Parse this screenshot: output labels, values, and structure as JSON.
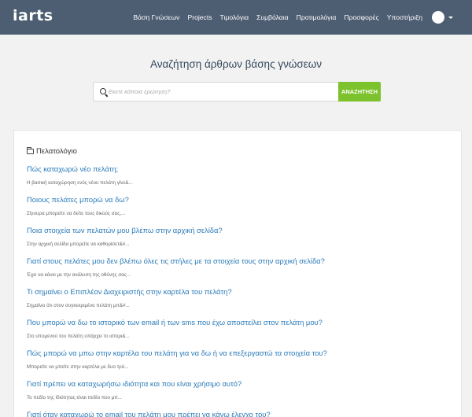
{
  "header": {
    "logo": "iarts",
    "nav": [
      "Βάση Γνώσεων",
      "Projects",
      "Τιμολόγια",
      "Συμβόλαια",
      "Προτιμολόγια",
      "Προσφορές",
      "Υποστήριξη"
    ],
    "avatar_icon": "user-avatar",
    "dropdown_icon": "caret-down-icon"
  },
  "hero": {
    "title": "Αναζήτηση άρθρων βάσης γνώσεων",
    "search_placeholder": "Εκετε κάποια ερώτηση?",
    "search_value": "",
    "search_button": "ΑΝΑΖΗΤΗΣΗ"
  },
  "colors": {
    "navbar": "#4d5d72",
    "accent_button": "#7cc22c",
    "link": "#2a7ab8"
  },
  "category": {
    "icon": "folder-icon",
    "name": "Πελατολόγιο"
  },
  "articles": [
    {
      "title": "Πώς καταχωρώ νέο πελάτη;",
      "excerpt": "Η βασική καταχώρηση ενός νέου πελάτη γίνε&..."
    },
    {
      "title": "Ποιους πελάτες μπορώ να δω?",
      "excerpt": "Σίγουρα μπορείτε να δείτε τους δικούς σας,..."
    },
    {
      "title": "Ποια στοιχεία των πελατών μου βλέπω στην αρχική σελίδα?",
      "excerpt": "Στην αρχική σελίδα μπορείτε να καθορίσετ&#..."
    },
    {
      "title": "Γιατί στους πελάτες μου δεν βλέπω όλες τις στήλες με τα στοιχεία τους στην αρχική σελίδα?",
      "excerpt": "Έχει να κάνει με την ανάλυση της οθόνης σας..."
    },
    {
      "title": "Τι σημαίνει ο Επιπλέον Διαχειριστής στην καρτέλα του πελάτη?",
      "excerpt": "Σημαίνει ότι στον συγκεκριμένο πελάτη μπ&#..."
    },
    {
      "title": "Που μπορώ να δω το ιστορικό των email ή των sms που έχω αποστείλει στον πελάτη μου?",
      "excerpt": "Στο υπομενού του πελάτη υπάρχει το ιστορι&..."
    },
    {
      "title": "Πώς μπορώ να μπω στην καρτέλα του πελάτη για να δω ή να επεξεργαστώ τα στοιχεία του?",
      "excerpt": "Μπορείτε να μπείτε στην καρτέλα με δυο τρό..."
    },
    {
      "title": "Γιατί πρέπει να καταχωρήσω ιδιότητα και που είναι χρήσιμο αυτό?",
      "excerpt": "Το πεδίο της Ιδιότητας είναι πεδίο που μπ..."
    },
    {
      "title": "Γιατί όταν καταχωρώ το email του πελάτη μου πρέπει να κάνω έλεγχο του?",
      "excerpt": ""
    }
  ]
}
